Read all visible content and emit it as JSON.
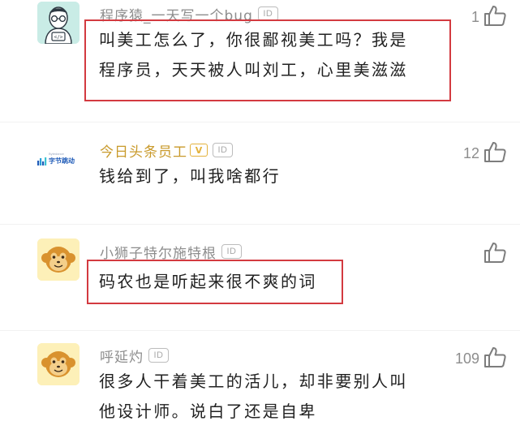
{
  "comments": [
    {
      "username": "程序猿_一天写一个bug",
      "id_badge": "ID",
      "likes": "1",
      "avatar_icon": "programmer-face-icon",
      "text_lines": [
        "叫美工怎么了，你很鄙视美工吗？我是",
        "程序员，天天被人叫刘工，心里美滋滋"
      ]
    },
    {
      "username": "今日头条员工",
      "id_badge": "ID",
      "verified_badge": "V",
      "likes": "12",
      "avatar_logo_small": "Bytedance",
      "avatar_logo_text": "字节跳动",
      "text_lines": [
        "钱给到了，叫我啥都行"
      ]
    },
    {
      "username": "小狮子特尔施特根",
      "id_badge": "ID",
      "likes": "",
      "avatar_icon": "monkey-icon",
      "text_lines": [
        "码农也是听起来很不爽的词"
      ]
    },
    {
      "username": "呼延灼",
      "id_badge": "ID",
      "likes": "109",
      "avatar_icon": "monkey-icon",
      "text_lines": [
        "很多人干着美工的活儿，却非要别人叫",
        "他设计师。说白了还是自卑"
      ]
    }
  ],
  "colors": {
    "highlight": "#d33a40",
    "username": "#8d8d8d",
    "username_verified": "#c99a2b",
    "text": "#222222"
  }
}
